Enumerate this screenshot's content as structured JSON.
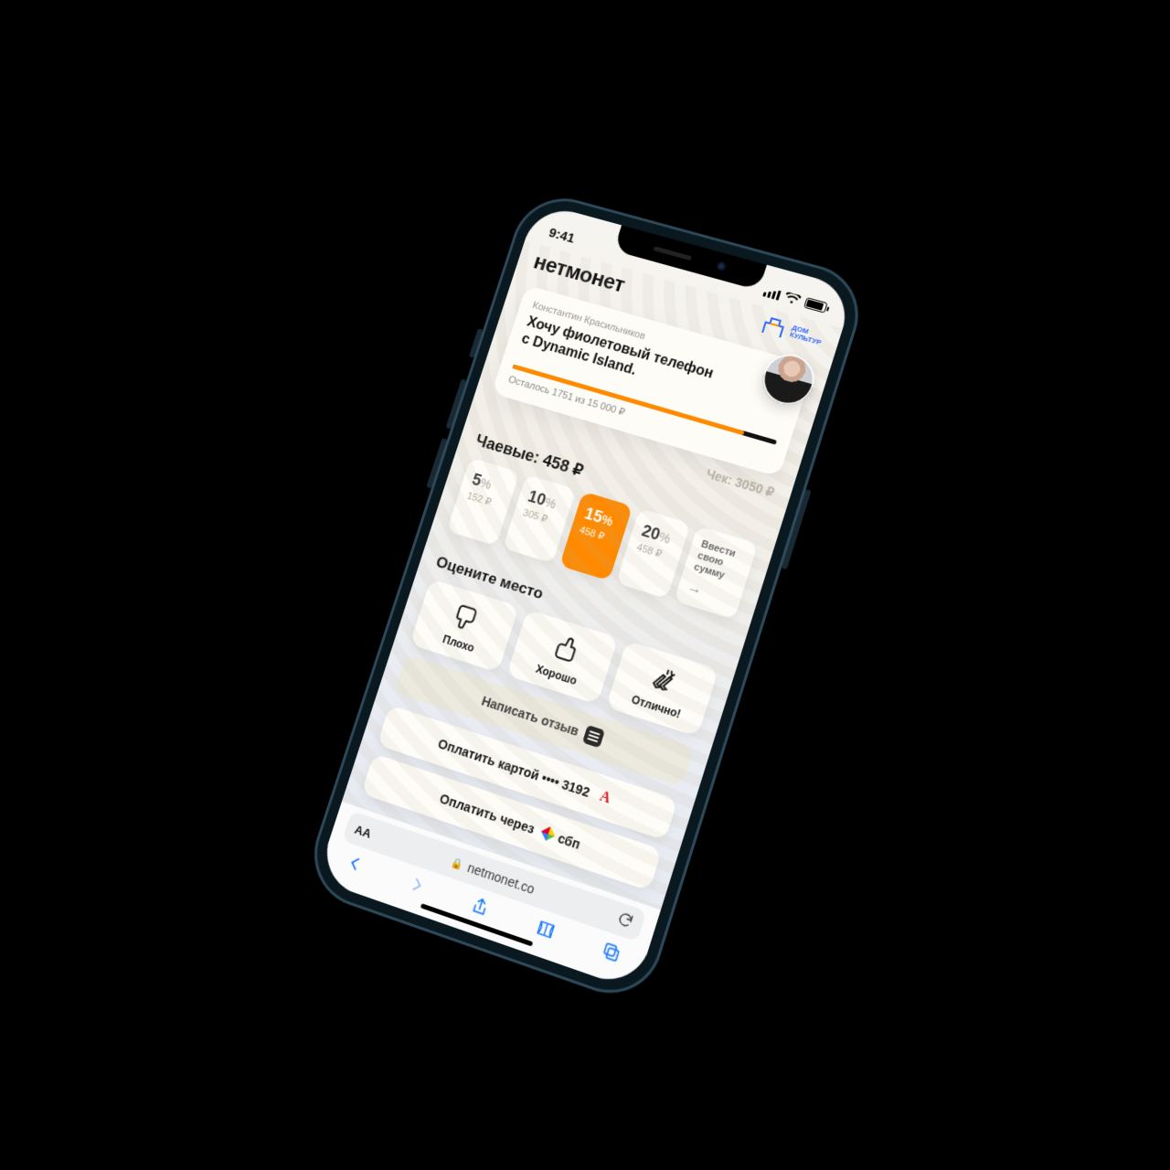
{
  "status": {
    "time": "9:41"
  },
  "header": {
    "brand": "нетмонет",
    "partner_line1": "ДОМ",
    "partner_line2": "КУЛЬТУР"
  },
  "wish_card": {
    "owner": "Константин Красильников",
    "wish_l1": "Хочу фиолетовый телефон",
    "wish_l2": "с Dynamic Island.",
    "progress_label": "Осталось 1751 из 15 000 ₽",
    "progress_pct": 88
  },
  "receipt": {
    "label": "Чек: 3050 ₽"
  },
  "tips": {
    "title": "Чаевые: 458 ₽",
    "options": [
      {
        "pct": "5",
        "sub": "152 ₽"
      },
      {
        "pct": "10",
        "sub": "305 ₽"
      },
      {
        "pct": "15",
        "sub": "458 ₽",
        "active": true
      },
      {
        "pct": "20",
        "sub": "458 ₽"
      }
    ],
    "custom_l1": "Ввести",
    "custom_l2": "свою сумму"
  },
  "rating": {
    "title": "Оцените место",
    "bad": "Плохо",
    "good": "Хорошо",
    "great": "Отлично!"
  },
  "review_button": "Написать отзыв",
  "pay": {
    "card_label": "Оплатить картой •••• 3192",
    "sbp_label": "Оплатить через",
    "sbp_name": "сбп"
  },
  "browser": {
    "aa": "AA",
    "lock": "🔒",
    "url": "netmonet.co"
  }
}
